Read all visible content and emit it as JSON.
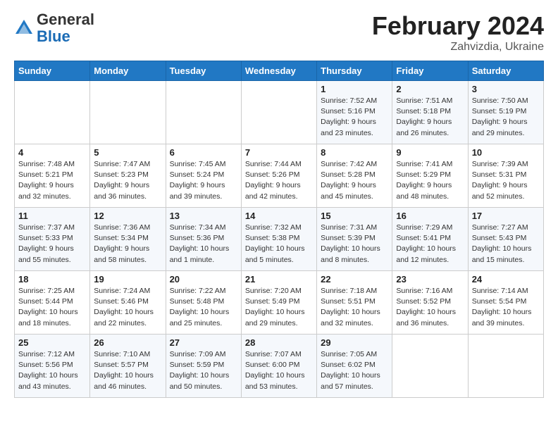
{
  "logo": {
    "general": "General",
    "blue": "Blue"
  },
  "title": "February 2024",
  "subtitle": "Zahvizdia, Ukraine",
  "days_of_week": [
    "Sunday",
    "Monday",
    "Tuesday",
    "Wednesday",
    "Thursday",
    "Friday",
    "Saturday"
  ],
  "weeks": [
    [
      {
        "day": "",
        "info": ""
      },
      {
        "day": "",
        "info": ""
      },
      {
        "day": "",
        "info": ""
      },
      {
        "day": "",
        "info": ""
      },
      {
        "day": "1",
        "info": "Sunrise: 7:52 AM\nSunset: 5:16 PM\nDaylight: 9 hours\nand 23 minutes."
      },
      {
        "day": "2",
        "info": "Sunrise: 7:51 AM\nSunset: 5:18 PM\nDaylight: 9 hours\nand 26 minutes."
      },
      {
        "day": "3",
        "info": "Sunrise: 7:50 AM\nSunset: 5:19 PM\nDaylight: 9 hours\nand 29 minutes."
      }
    ],
    [
      {
        "day": "4",
        "info": "Sunrise: 7:48 AM\nSunset: 5:21 PM\nDaylight: 9 hours\nand 32 minutes."
      },
      {
        "day": "5",
        "info": "Sunrise: 7:47 AM\nSunset: 5:23 PM\nDaylight: 9 hours\nand 36 minutes."
      },
      {
        "day": "6",
        "info": "Sunrise: 7:45 AM\nSunset: 5:24 PM\nDaylight: 9 hours\nand 39 minutes."
      },
      {
        "day": "7",
        "info": "Sunrise: 7:44 AM\nSunset: 5:26 PM\nDaylight: 9 hours\nand 42 minutes."
      },
      {
        "day": "8",
        "info": "Sunrise: 7:42 AM\nSunset: 5:28 PM\nDaylight: 9 hours\nand 45 minutes."
      },
      {
        "day": "9",
        "info": "Sunrise: 7:41 AM\nSunset: 5:29 PM\nDaylight: 9 hours\nand 48 minutes."
      },
      {
        "day": "10",
        "info": "Sunrise: 7:39 AM\nSunset: 5:31 PM\nDaylight: 9 hours\nand 52 minutes."
      }
    ],
    [
      {
        "day": "11",
        "info": "Sunrise: 7:37 AM\nSunset: 5:33 PM\nDaylight: 9 hours\nand 55 minutes."
      },
      {
        "day": "12",
        "info": "Sunrise: 7:36 AM\nSunset: 5:34 PM\nDaylight: 9 hours\nand 58 minutes."
      },
      {
        "day": "13",
        "info": "Sunrise: 7:34 AM\nSunset: 5:36 PM\nDaylight: 10 hours\nand 1 minute."
      },
      {
        "day": "14",
        "info": "Sunrise: 7:32 AM\nSunset: 5:38 PM\nDaylight: 10 hours\nand 5 minutes."
      },
      {
        "day": "15",
        "info": "Sunrise: 7:31 AM\nSunset: 5:39 PM\nDaylight: 10 hours\nand 8 minutes."
      },
      {
        "day": "16",
        "info": "Sunrise: 7:29 AM\nSunset: 5:41 PM\nDaylight: 10 hours\nand 12 minutes."
      },
      {
        "day": "17",
        "info": "Sunrise: 7:27 AM\nSunset: 5:43 PM\nDaylight: 10 hours\nand 15 minutes."
      }
    ],
    [
      {
        "day": "18",
        "info": "Sunrise: 7:25 AM\nSunset: 5:44 PM\nDaylight: 10 hours\nand 18 minutes."
      },
      {
        "day": "19",
        "info": "Sunrise: 7:24 AM\nSunset: 5:46 PM\nDaylight: 10 hours\nand 22 minutes."
      },
      {
        "day": "20",
        "info": "Sunrise: 7:22 AM\nSunset: 5:48 PM\nDaylight: 10 hours\nand 25 minutes."
      },
      {
        "day": "21",
        "info": "Sunrise: 7:20 AM\nSunset: 5:49 PM\nDaylight: 10 hours\nand 29 minutes."
      },
      {
        "day": "22",
        "info": "Sunrise: 7:18 AM\nSunset: 5:51 PM\nDaylight: 10 hours\nand 32 minutes."
      },
      {
        "day": "23",
        "info": "Sunrise: 7:16 AM\nSunset: 5:52 PM\nDaylight: 10 hours\nand 36 minutes."
      },
      {
        "day": "24",
        "info": "Sunrise: 7:14 AM\nSunset: 5:54 PM\nDaylight: 10 hours\nand 39 minutes."
      }
    ],
    [
      {
        "day": "25",
        "info": "Sunrise: 7:12 AM\nSunset: 5:56 PM\nDaylight: 10 hours\nand 43 minutes."
      },
      {
        "day": "26",
        "info": "Sunrise: 7:10 AM\nSunset: 5:57 PM\nDaylight: 10 hours\nand 46 minutes."
      },
      {
        "day": "27",
        "info": "Sunrise: 7:09 AM\nSunset: 5:59 PM\nDaylight: 10 hours\nand 50 minutes."
      },
      {
        "day": "28",
        "info": "Sunrise: 7:07 AM\nSunset: 6:00 PM\nDaylight: 10 hours\nand 53 minutes."
      },
      {
        "day": "29",
        "info": "Sunrise: 7:05 AM\nSunset: 6:02 PM\nDaylight: 10 hours\nand 57 minutes."
      },
      {
        "day": "",
        "info": ""
      },
      {
        "day": "",
        "info": ""
      }
    ]
  ]
}
